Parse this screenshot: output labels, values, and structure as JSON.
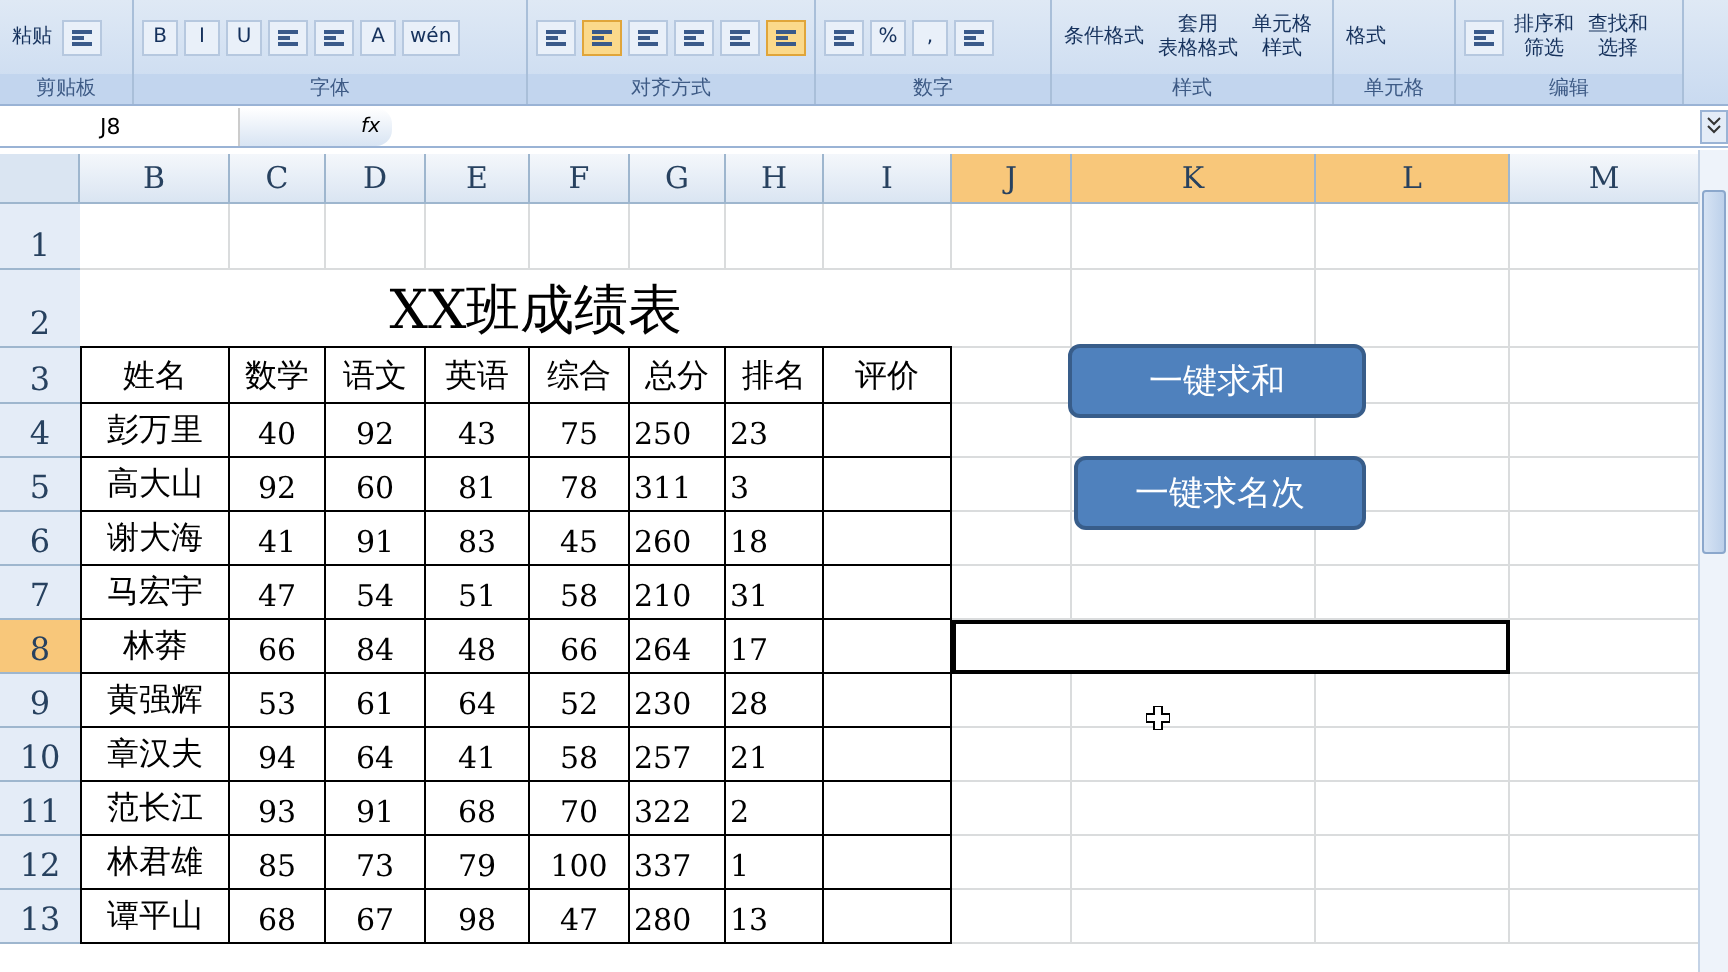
{
  "ribbon": {
    "groups": [
      {
        "label": "剪贴板",
        "items": [
          {
            "kind": "big",
            "label": "粘贴"
          },
          {
            "kind": "icon"
          }
        ]
      },
      {
        "label": "字体",
        "items": [
          {
            "kind": "glyph",
            "label": "B",
            "pressed": false
          },
          {
            "kind": "glyph",
            "label": "I",
            "pressed": false
          },
          {
            "kind": "glyph",
            "label": "U",
            "pressed": false
          },
          {
            "kind": "icon"
          },
          {
            "kind": "icon"
          },
          {
            "kind": "glyph",
            "label": "A",
            "pressed": false
          },
          {
            "kind": "glyph",
            "label": "wén",
            "pressed": false
          }
        ]
      },
      {
        "label": "对齐方式",
        "items": [
          {
            "kind": "icon",
            "pressed": false
          },
          {
            "kind": "icon",
            "pressed": true
          },
          {
            "kind": "icon",
            "pressed": false
          },
          {
            "kind": "icon",
            "pressed": false
          },
          {
            "kind": "icon",
            "pressed": false
          },
          {
            "kind": "icon",
            "pressed": true
          }
        ]
      },
      {
        "label": "数字",
        "items": [
          {
            "kind": "icon"
          },
          {
            "kind": "glyph",
            "label": "%",
            "pressed": false
          },
          {
            "kind": "glyph",
            "label": ",",
            "pressed": false
          },
          {
            "kind": "icon"
          }
        ]
      },
      {
        "label": "样式",
        "items": [
          {
            "kind": "text",
            "lines": [
              "条件格式"
            ]
          },
          {
            "kind": "text",
            "lines": [
              "套用",
              "表格格式"
            ]
          },
          {
            "kind": "text",
            "lines": [
              "单元格",
              "样式"
            ]
          }
        ]
      },
      {
        "label": "单元格",
        "items": [
          {
            "kind": "text",
            "lines": [
              "格式"
            ]
          }
        ]
      },
      {
        "label": "编辑",
        "items": [
          {
            "kind": "icon"
          },
          {
            "kind": "text",
            "lines": [
              "排序和",
              "筛选"
            ]
          },
          {
            "kind": "text",
            "lines": [
              "查找和",
              "选择"
            ]
          }
        ]
      }
    ]
  },
  "name_box": "J8",
  "fx": "fx",
  "columns": [
    {
      "label": "B",
      "selected": false
    },
    {
      "label": "C",
      "selected": false
    },
    {
      "label": "D",
      "selected": false
    },
    {
      "label": "E",
      "selected": false
    },
    {
      "label": "F",
      "selected": false
    },
    {
      "label": "G",
      "selected": false
    },
    {
      "label": "H",
      "selected": false
    },
    {
      "label": "I",
      "selected": false
    },
    {
      "label": "J",
      "selected": true
    },
    {
      "label": "K",
      "selected": true
    },
    {
      "label": "L",
      "selected": true
    },
    {
      "label": "M",
      "selected": false
    }
  ],
  "row_numbers": [
    {
      "label": "1",
      "selected": false
    },
    {
      "label": "2",
      "selected": false
    },
    {
      "label": "3",
      "selected": false
    },
    {
      "label": "4",
      "selected": false
    },
    {
      "label": "5",
      "selected": false
    },
    {
      "label": "6",
      "selected": false
    },
    {
      "label": "7",
      "selected": false
    },
    {
      "label": "8",
      "selected": true
    },
    {
      "label": "9",
      "selected": false
    },
    {
      "label": "10",
      "selected": false
    },
    {
      "label": "11",
      "selected": false
    },
    {
      "label": "12",
      "selected": false
    },
    {
      "label": "13",
      "selected": false
    }
  ],
  "table": {
    "title": "XX班成绩表",
    "headers": [
      "姓名",
      "数学",
      "语文",
      "英语",
      "综合",
      "总分",
      "排名",
      "评价"
    ],
    "rows": [
      [
        "彭万里",
        "40",
        "92",
        "43",
        "75",
        "250",
        "23"
      ],
      [
        "高大山",
        "92",
        "60",
        "81",
        "78",
        "311",
        "3"
      ],
      [
        "谢大海",
        "41",
        "91",
        "83",
        "45",
        "260",
        "18"
      ],
      [
        "马宏宇",
        "47",
        "54",
        "51",
        "58",
        "210",
        "31"
      ],
      [
        "林莽",
        "66",
        "84",
        "48",
        "66",
        "264",
        "17"
      ],
      [
        "黄强辉",
        "53",
        "61",
        "64",
        "52",
        "230",
        "28"
      ],
      [
        "章汉夫",
        "94",
        "64",
        "41",
        "58",
        "257",
        "21"
      ],
      [
        "范长江",
        "93",
        "91",
        "68",
        "70",
        "322",
        "2"
      ],
      [
        "林君雄",
        "85",
        "73",
        "79",
        "100",
        "337",
        "1"
      ],
      [
        "谭平山",
        "68",
        "67",
        "98",
        "47",
        "280",
        "13"
      ]
    ]
  },
  "buttons": [
    {
      "label": "一键求和"
    },
    {
      "label": "一键求名次"
    }
  ]
}
